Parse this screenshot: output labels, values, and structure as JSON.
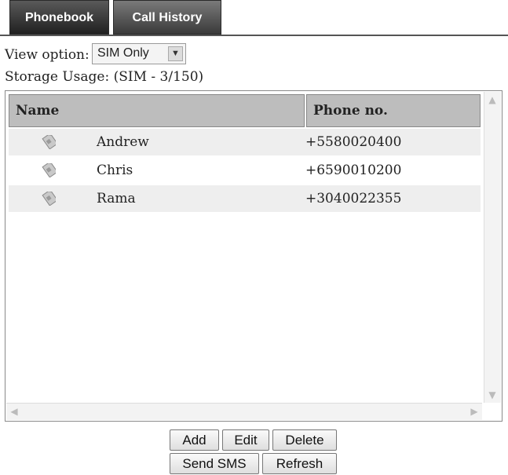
{
  "tabs": {
    "phonebook": "Phonebook",
    "call_history": "Call History"
  },
  "view_option": {
    "label": "View option:",
    "selected": "SIM Only"
  },
  "storage_usage": "Storage Usage: (SIM - 3/150)",
  "table": {
    "headers": {
      "name": "Name",
      "phone": "Phone no."
    },
    "rows": [
      {
        "name": "Andrew",
        "phone": "+5580020400",
        "icon": "sim-card-icon"
      },
      {
        "name": "Chris",
        "phone": "+6590010200",
        "icon": "sim-card-icon"
      },
      {
        "name": "Rama",
        "phone": "+3040022355",
        "icon": "sim-card-icon"
      }
    ]
  },
  "buttons": {
    "add": "Add",
    "edit": "Edit",
    "delete": "Delete",
    "send_sms": "Send SMS",
    "refresh": "Refresh"
  }
}
